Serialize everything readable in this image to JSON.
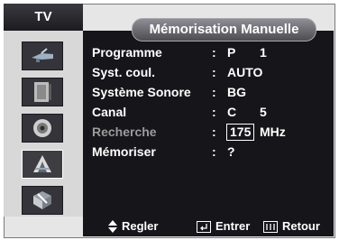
{
  "header": {
    "tab_label": "TV",
    "title": "Mémorisation Manuelle"
  },
  "sidebar": {
    "items": [
      {
        "icon": "antenna-icon"
      },
      {
        "icon": "picture-icon"
      },
      {
        "icon": "speaker-icon"
      },
      {
        "icon": "channel-icon"
      },
      {
        "icon": "setup-icon"
      }
    ],
    "active_index": 3
  },
  "menu": {
    "rows": [
      {
        "label": "Programme",
        "colon": ":",
        "value": "P",
        "value2": "1"
      },
      {
        "label": "Syst. coul.",
        "colon": ":",
        "value": "AUTO"
      },
      {
        "label": "Système Sonore",
        "colon": ":",
        "value": "BG"
      },
      {
        "label": "Canal",
        "colon": ":",
        "value": "C",
        "value2": "5"
      },
      {
        "label": "Recherche",
        "colon": ":",
        "value": "175",
        "unit": "MHz"
      },
      {
        "label": "Mémoriser",
        "colon": ":",
        "value": "?"
      }
    ]
  },
  "footer": {
    "adjust_label": "Regler",
    "enter_label": "Entrer",
    "return_label": "Retour"
  }
}
